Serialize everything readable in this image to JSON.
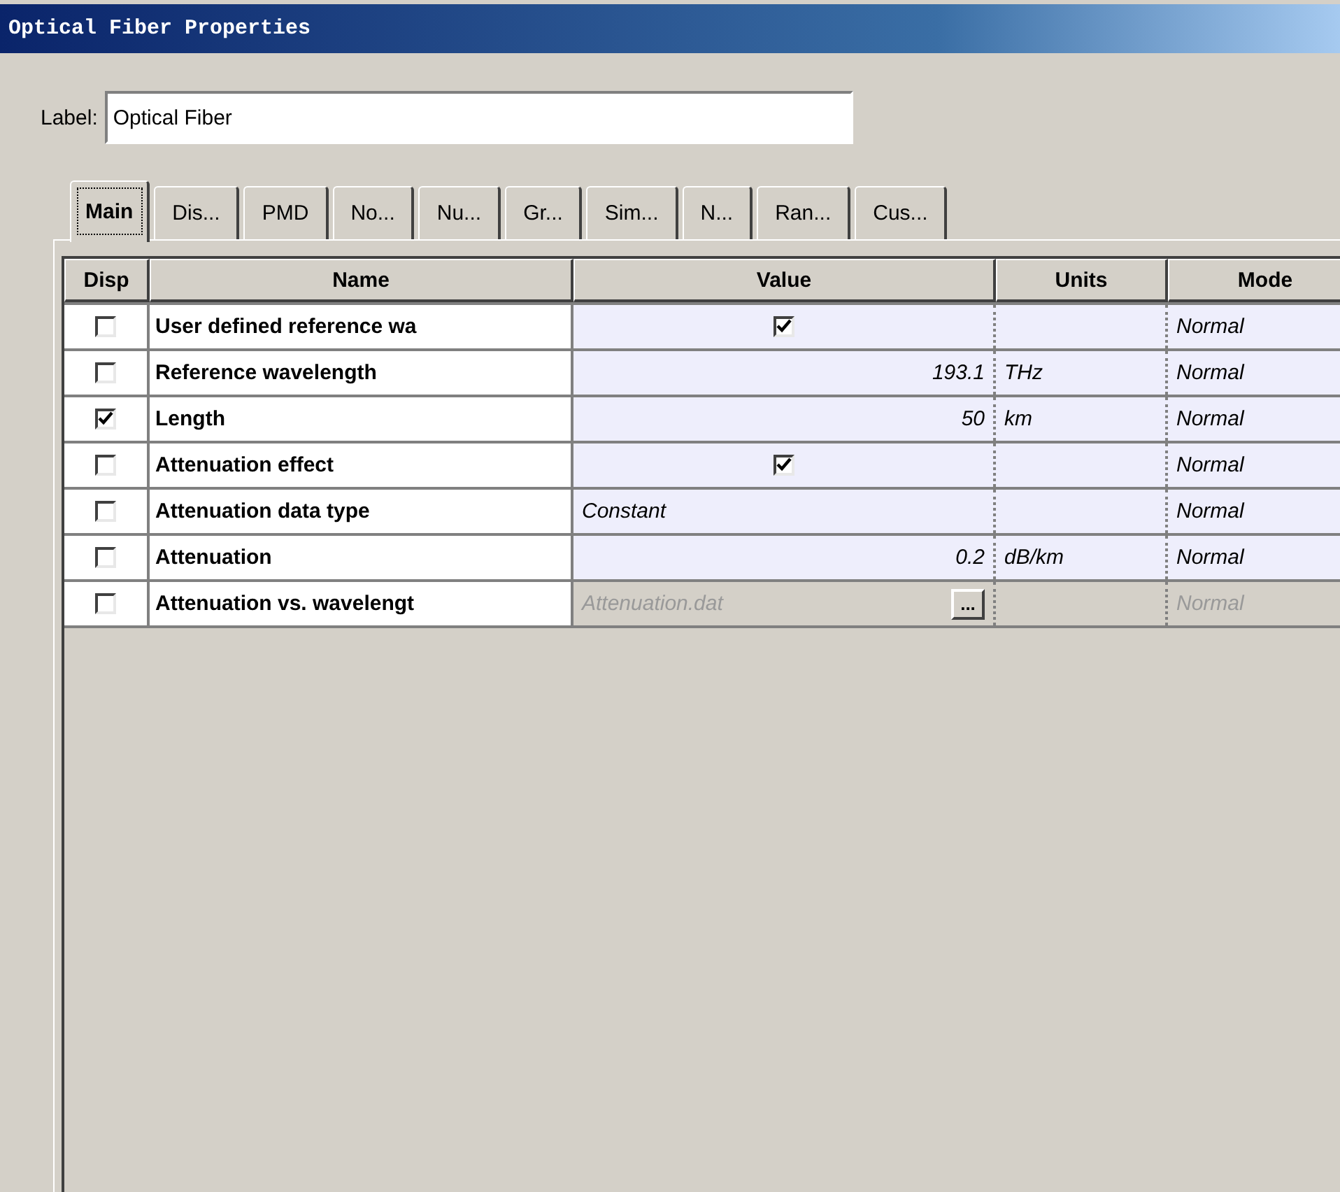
{
  "window": {
    "title": "Optical Fiber Properties"
  },
  "label_field": {
    "label": "Label:",
    "value": "Optical Fiber"
  },
  "tabs": [
    {
      "label": "Main",
      "selected": true
    },
    {
      "label": "Dis...",
      "selected": false
    },
    {
      "label": "PMD",
      "selected": false
    },
    {
      "label": "No...",
      "selected": false
    },
    {
      "label": "Nu...",
      "selected": false
    },
    {
      "label": "Gr...",
      "selected": false
    },
    {
      "label": "Sim...",
      "selected": false
    },
    {
      "label": "N...",
      "selected": false
    },
    {
      "label": "Ran...",
      "selected": false
    },
    {
      "label": "Cus...",
      "selected": false
    }
  ],
  "table": {
    "columns": [
      "Disp",
      "Name",
      "Value",
      "Units",
      "Mode"
    ],
    "rows": [
      {
        "disp": false,
        "name": "User defined reference wa",
        "kind": "checkbox",
        "checked": true,
        "units": "",
        "mode": "Normal",
        "disabled": false
      },
      {
        "disp": false,
        "name": "Reference wavelength",
        "kind": "number",
        "value": "193.1",
        "units": "THz",
        "mode": "Normal",
        "disabled": false
      },
      {
        "disp": true,
        "name": "Length",
        "kind": "number",
        "value": "50",
        "units": "km",
        "mode": "Normal",
        "disabled": false
      },
      {
        "disp": false,
        "name": "Attenuation effect",
        "kind": "checkbox",
        "checked": true,
        "units": "",
        "mode": "Normal",
        "disabled": false
      },
      {
        "disp": false,
        "name": "Attenuation data type",
        "kind": "choice",
        "value": "Constant",
        "units": "",
        "mode": "Normal",
        "disabled": false
      },
      {
        "disp": false,
        "name": "Attenuation",
        "kind": "number",
        "value": "0.2",
        "units": "dB/km",
        "mode": "Normal",
        "disabled": false
      },
      {
        "disp": false,
        "name": "Attenuation vs. wavelengt",
        "kind": "file",
        "value": "Attenuation.dat",
        "button": "...",
        "units": "",
        "mode": "Normal",
        "disabled": true
      }
    ]
  }
}
